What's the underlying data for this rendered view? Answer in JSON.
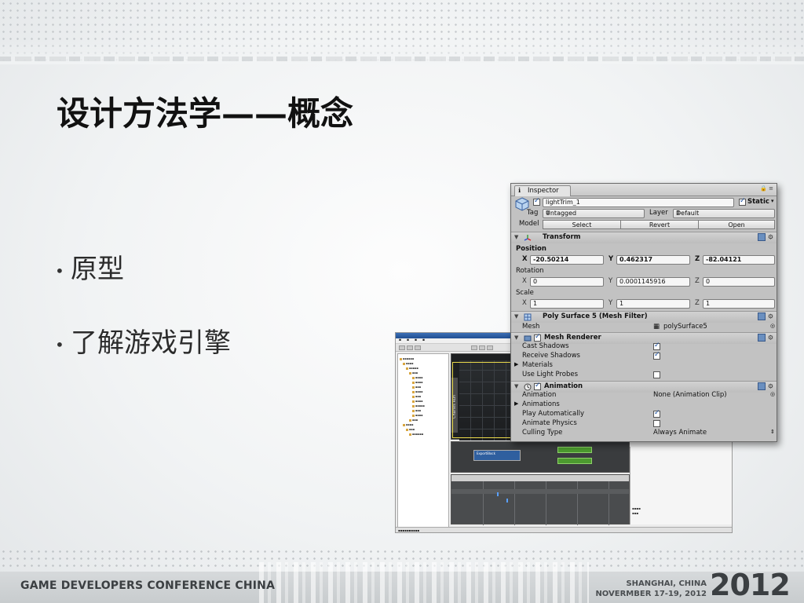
{
  "slide": {
    "title": "设计方法学——概念",
    "bullets": [
      {
        "text": "原型"
      },
      {
        "text": "了解游戏引擎"
      }
    ],
    "footer": {
      "conference": "GAME DEVELOPERS CONFERENCE CHINA",
      "city": "SHANGHAI, CHINA",
      "dates": "NOVERMBER 17-19, 2012",
      "year": "2012"
    }
  },
  "inspector": {
    "tab_label": "Inspector",
    "tab_icon": "info-icon",
    "object_name": "lightTrim_1",
    "static_label": "Static",
    "active": true,
    "static": true,
    "tag_label": "Tag",
    "tag_value": "Untagged",
    "layer_label": "Layer",
    "layer_value": "Default",
    "model_label": "Model",
    "model_buttons": [
      "Select",
      "Revert",
      "Open"
    ],
    "transform": {
      "title": "Transform",
      "position_label": "Position",
      "position": {
        "x": "-20.50214",
        "y": "0.462317",
        "z": "-82.04121"
      },
      "rotation_label": "Rotation",
      "rotation": {
        "x": "0",
        "y": "0.0001145916",
        "z": "0"
      },
      "scale_label": "Scale",
      "scale": {
        "x": "1",
        "y": "1",
        "z": "1"
      },
      "axis_labels": {
        "x": "X",
        "y": "Y",
        "z": "Z"
      }
    },
    "mesh_filter": {
      "title": "Poly Surface 5 (Mesh Filter)",
      "mesh_label": "Mesh",
      "mesh_value": "polySurface5"
    },
    "mesh_renderer": {
      "title": "Mesh Renderer",
      "enabled": true,
      "props": [
        {
          "label": "Cast Shadows",
          "checked": true
        },
        {
          "label": "Receive Shadows",
          "checked": true
        }
      ],
      "materials_label": "Materials",
      "light_probes": {
        "label": "Use Light Probes",
        "checked": false
      }
    },
    "animation": {
      "title": "Animation",
      "enabled": true,
      "animation_label": "Animation",
      "animation_value": "None (Animation Clip)",
      "animations_label": "Animations",
      "play_auto": {
        "label": "Play Automatically",
        "checked": true
      },
      "animate_physics": {
        "label": "Animate Physics",
        "checked": false
      },
      "culling_label": "Culling Type",
      "culling_value": "Always Animate"
    }
  },
  "editor": {
    "view_label": "Charles Run",
    "node_label": "ExportBlock"
  }
}
